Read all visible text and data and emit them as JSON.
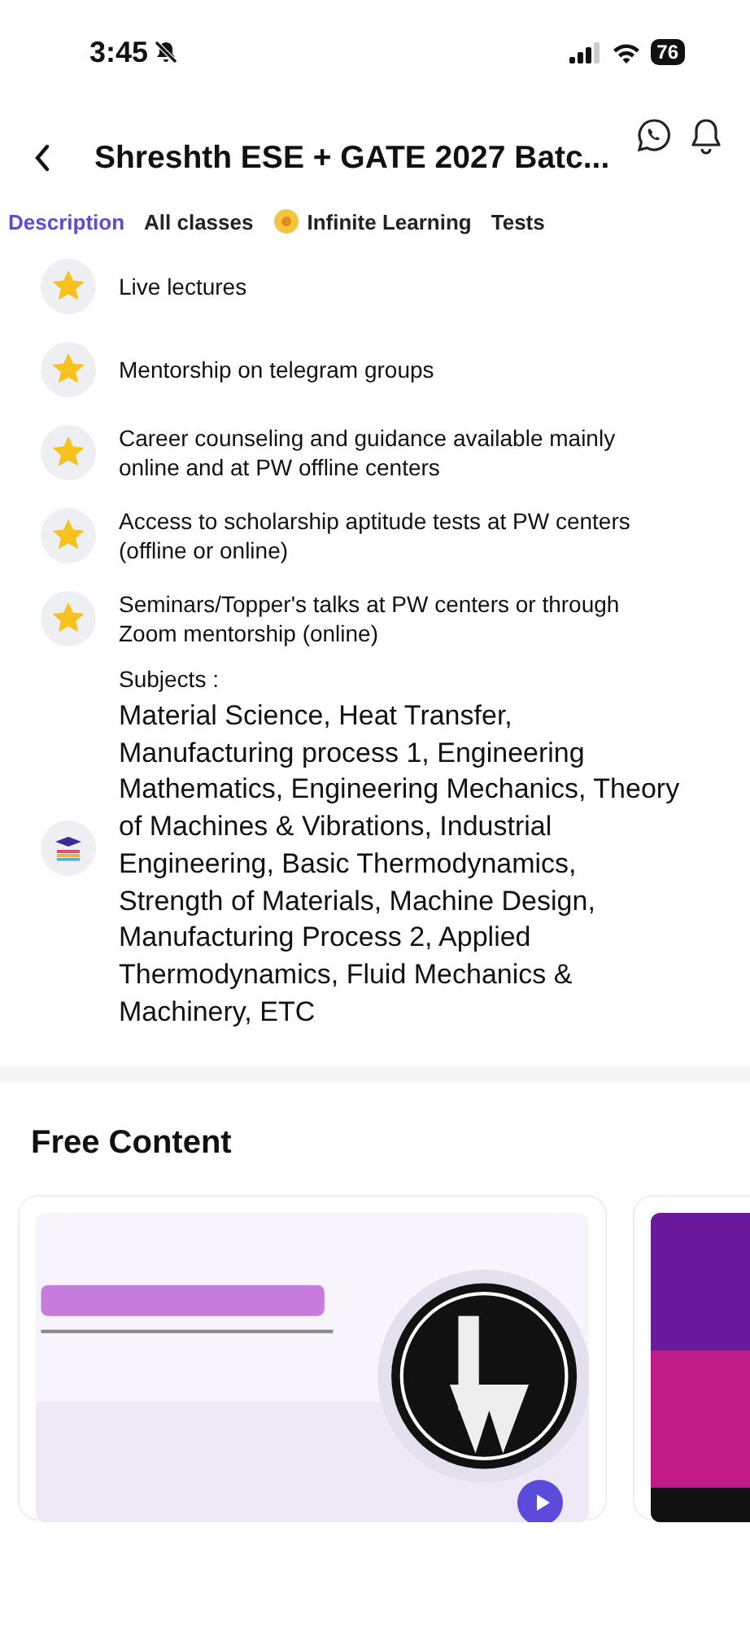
{
  "status_bar": {
    "time": "3:45",
    "battery": "76"
  },
  "header": {
    "title": "Shreshth ESE + GATE 2027 Batc..."
  },
  "tabs": [
    {
      "label": "Description",
      "selected": true,
      "kind": "plain"
    },
    {
      "label": "All classes",
      "selected": false,
      "kind": "plain"
    },
    {
      "label": "Infinite Learning",
      "selected": false,
      "kind": "featured"
    },
    {
      "label": "Tests",
      "selected": false,
      "kind": "plain"
    }
  ],
  "features": [
    {
      "text": "Live lectures"
    },
    {
      "text": "Mentorship on telegram groups"
    },
    {
      "text": "Career counseling and guidance available mainly online and at PW offline centers"
    },
    {
      "text": "Access to scholarship aptitude tests at PW centers (offline or online)"
    },
    {
      "text": "Seminars/Topper's talks at PW centers or through Zoom mentorship (online)"
    }
  ],
  "subjects": {
    "label": "Subjects :",
    "text": "Material Science, Heat Transfer, Manufacturing process 1, Engineering Mathematics, Engineering Mechanics, Theory of Machines & Vibrations, Industrial Engineering, Basic Thermodynamics, Strength of Materials, Machine Design, Manufacturing Process 2, Applied Thermodynamics, Fluid Mechanics & Machinery, ETC"
  },
  "free_content": {
    "title": "Free Content",
    "videos": [
      {
        "kind": "picture",
        "play": true
      },
      {
        "kind": "picture",
        "play": false
      }
    ]
  }
}
